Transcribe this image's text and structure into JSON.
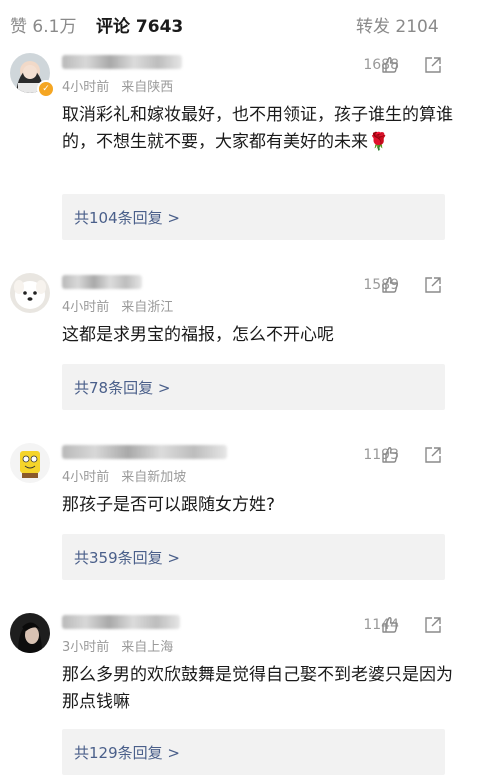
{
  "header": {
    "likes_tab": "赞 6.1万",
    "comments_tab": "评论 7643",
    "reposts_tab": "转发 2104"
  },
  "comments": [
    {
      "time": "4小时前",
      "location": "来自陕西",
      "likes": "1688",
      "text": "取消彩礼和嫁妆最好，也不用领证，孩子谁生的算谁的，不想生就不要，大家都有美好的未来🌹",
      "replies": "共104条回复 >"
    },
    {
      "time": "4小时前",
      "location": "来自浙江",
      "likes": "1589",
      "text": "这都是求男宝的福报，怎么不开心呢",
      "replies": "共78条回复 >"
    },
    {
      "time": "4小时前",
      "location": "来自新加坡",
      "likes": "1193",
      "text": "那孩子是否可以跟随女方姓?",
      "replies": "共359条回复 >"
    },
    {
      "time": "3小时前",
      "location": "来自上海",
      "likes": "1144",
      "text": "那么多男的欢欣鼓舞是觉得自己娶不到老婆只是因为那点钱嘛",
      "replies": "共129条回复 >"
    }
  ],
  "icons": {
    "like": "thumbs-up-icon",
    "share": "share-icon"
  },
  "colors": {
    "reply_link": "#4a5f8a",
    "meta_text": "#9a9a9a",
    "reply_box": "#f2f2f2",
    "verified_badge": "#f5a623"
  }
}
